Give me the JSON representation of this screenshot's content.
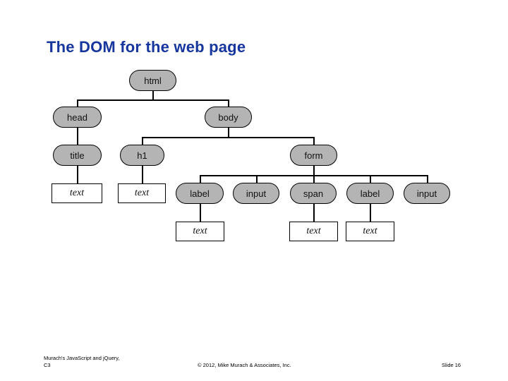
{
  "slide": {
    "title": "The DOM for the web page",
    "title_color": "#16369e",
    "background_color": "#ffffff"
  },
  "diagram": {
    "type": "tree",
    "element_node_fill": "#b4b4b4",
    "text_node_fill": "#ffffff",
    "border_color": "#000000",
    "nodes": [
      {
        "id": "html",
        "label": "html",
        "kind": "element"
      },
      {
        "id": "head",
        "label": "head",
        "kind": "element"
      },
      {
        "id": "body",
        "label": "body",
        "kind": "element"
      },
      {
        "id": "title",
        "label": "title",
        "kind": "element"
      },
      {
        "id": "h1",
        "label": "h1",
        "kind": "element"
      },
      {
        "id": "form",
        "label": "form",
        "kind": "element"
      },
      {
        "id": "title-text",
        "label": "text",
        "kind": "text"
      },
      {
        "id": "h1-text",
        "label": "text",
        "kind": "text"
      },
      {
        "id": "label1",
        "label": "label",
        "kind": "element"
      },
      {
        "id": "input1",
        "label": "input",
        "kind": "element"
      },
      {
        "id": "span",
        "label": "span",
        "kind": "element"
      },
      {
        "id": "label2",
        "label": "label",
        "kind": "element"
      },
      {
        "id": "input2",
        "label": "input",
        "kind": "element"
      },
      {
        "id": "label1-text",
        "label": "text",
        "kind": "text"
      },
      {
        "id": "span-text",
        "label": "text",
        "kind": "text"
      },
      {
        "id": "label2-text",
        "label": "text",
        "kind": "text"
      }
    ],
    "edges": [
      {
        "from": "html",
        "to": "head"
      },
      {
        "from": "html",
        "to": "body"
      },
      {
        "from": "head",
        "to": "title"
      },
      {
        "from": "body",
        "to": "h1"
      },
      {
        "from": "body",
        "to": "form"
      },
      {
        "from": "title",
        "to": "title-text"
      },
      {
        "from": "h1",
        "to": "h1-text"
      },
      {
        "from": "form",
        "to": "label1"
      },
      {
        "from": "form",
        "to": "input1"
      },
      {
        "from": "form",
        "to": "span"
      },
      {
        "from": "form",
        "to": "label2"
      },
      {
        "from": "form",
        "to": "input2"
      },
      {
        "from": "label1",
        "to": "label1-text"
      },
      {
        "from": "span",
        "to": "span-text"
      },
      {
        "from": "label2",
        "to": "label2-text"
      }
    ]
  },
  "footer": {
    "left_line1": "Murach's JavaScript and jQuery,",
    "left_line2": "C3",
    "center": "© 2012, Mike Murach & Associates, Inc.",
    "right": "Slide 16"
  }
}
